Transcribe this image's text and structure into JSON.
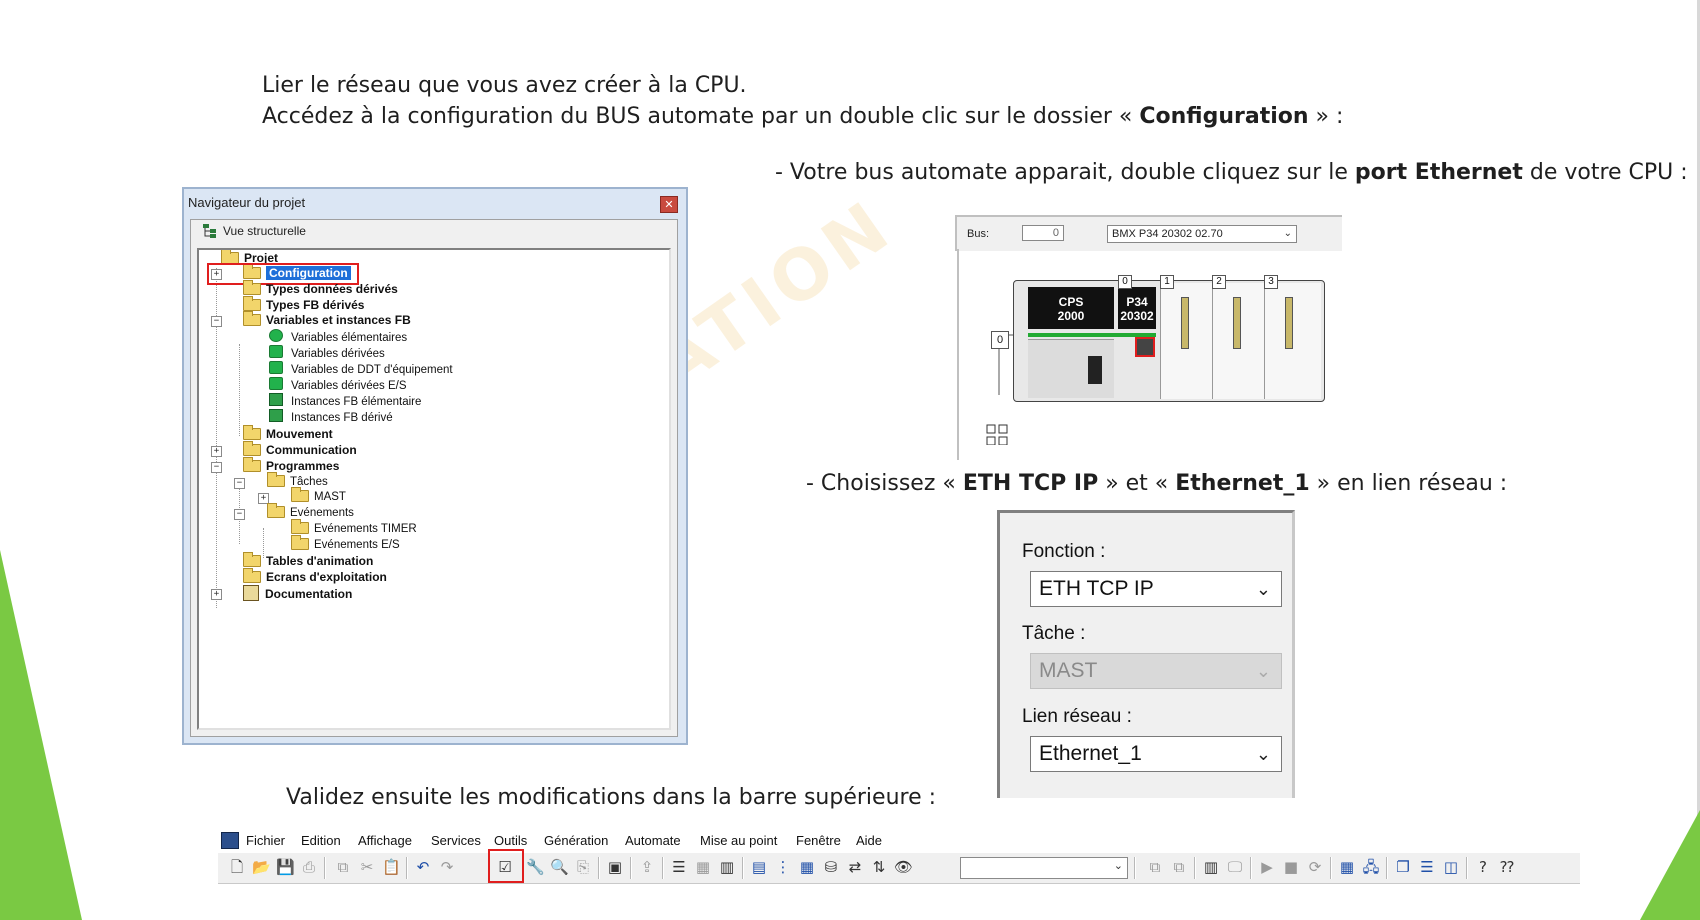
{
  "slide": {
    "line1": "Lier le réseau que vous avez créer à la CPU.",
    "line2_pre": "Accédez à la configuration du BUS automate par un double clic sur le dossier « ",
    "line2_bold": "Configuration",
    "line2_post": " » :",
    "bus_pre": "- Votre bus automate apparait, double cliquez sur le ",
    "bus_bold": "port Ethernet",
    "bus_post": " de votre CPU :",
    "choose_pre": "- Choisissez « ",
    "choose_bold1": "ETH TCP IP",
    "choose_mid": " »  et « ",
    "choose_bold2": "Ethernet_1",
    "choose_post": " » en lien réseau :",
    "validate": "Validez ensuite les modifications dans la barre supérieure :",
    "watermark": "AUTOMATION"
  },
  "navigator": {
    "title": "Navigateur du projet",
    "close": "✕",
    "view_label": "Vue structurelle",
    "items": [
      {
        "label": "Projet"
      },
      {
        "label": "Configuration"
      },
      {
        "label": "Types données dérivés"
      },
      {
        "label": "Types FB dérivés"
      },
      {
        "label": "Variables et instances FB"
      },
      {
        "label": "Variables élémentaires"
      },
      {
        "label": "Variables dérivées"
      },
      {
        "label": "Variables de DDT d'équipement"
      },
      {
        "label": "Variables dérivées E/S"
      },
      {
        "label": "Instances FB élémentaire"
      },
      {
        "label": "Instances FB dérivé"
      },
      {
        "label": "Mouvement"
      },
      {
        "label": "Communication"
      },
      {
        "label": "Programmes"
      },
      {
        "label": "Tâches"
      },
      {
        "label": "MAST"
      },
      {
        "label": "Evénements"
      },
      {
        "label": "Evénements TIMER"
      },
      {
        "label": "Evénements E/S"
      },
      {
        "label": "Tables d'animation"
      },
      {
        "label": "Ecrans d'exploitation"
      },
      {
        "label": "Documentation"
      }
    ]
  },
  "bus": {
    "label": "Bus:",
    "number": "0",
    "processor": "BMX P34 20302   02.70",
    "cps_line1": "CPS",
    "cps_line2": "2000",
    "cpu_line1": "P34",
    "cpu_line2": "20302",
    "slots": [
      "0",
      "1",
      "2",
      "3"
    ],
    "bus_zero": "0"
  },
  "function_panel": {
    "fonction_label": "Fonction :",
    "fonction_value": "ETH TCP IP",
    "tache_label": "Tâche :",
    "tache_value": "MAST",
    "lien_label": "Lien réseau :",
    "lien_value": "Ethernet_1"
  },
  "menubar": {
    "items": [
      "Fichier",
      "Edition",
      "Affichage",
      "Services",
      "Outils",
      "Génération",
      "Automate",
      "Mise au point",
      "Fenêtre",
      "Aide"
    ]
  },
  "colors": {
    "accent_green": "#7ac943",
    "highlight_red": "#e01e1e",
    "selection_blue": "#1e6fd9"
  }
}
